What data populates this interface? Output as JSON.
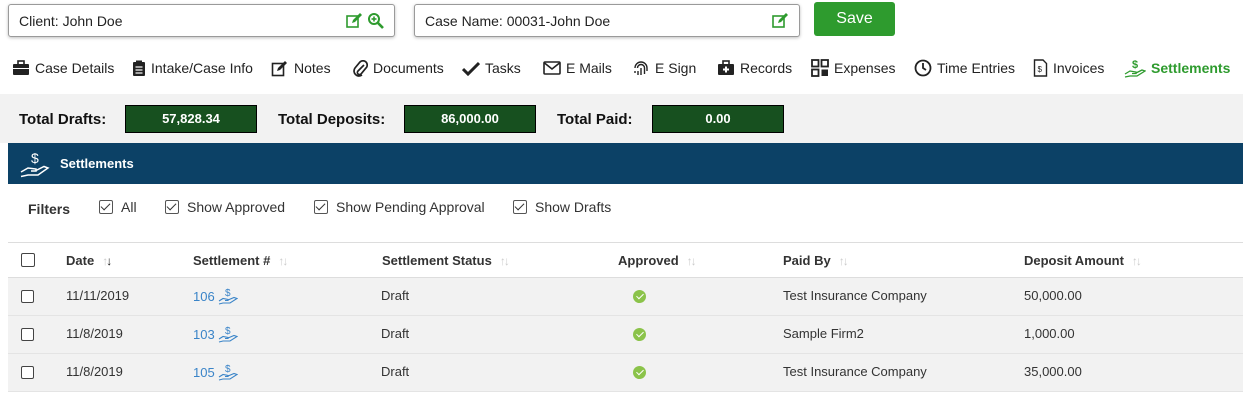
{
  "header": {
    "client_label": "Client: John Doe",
    "case_label": "Case Name: 00031-John Doe",
    "save_label": "Save"
  },
  "tabs": [
    {
      "label": "Case Details",
      "icon": "briefcase-icon"
    },
    {
      "label": "Intake/Case Info",
      "icon": "clipboard-icon"
    },
    {
      "label": "Notes",
      "icon": "edit-icon"
    },
    {
      "label": "Documents",
      "icon": "paperclip-icon"
    },
    {
      "label": "Tasks",
      "icon": "checkmark-icon"
    },
    {
      "label": "E Mails",
      "icon": "envelope-icon"
    },
    {
      "label": "E Sign",
      "icon": "fingerprint-icon"
    },
    {
      "label": "Records",
      "icon": "medical-kit-icon"
    },
    {
      "label": "Expenses",
      "icon": "grid-icon"
    },
    {
      "label": "Time Entries",
      "icon": "clock-icon"
    },
    {
      "label": "Invoices",
      "icon": "invoice-icon"
    },
    {
      "label": "Settlements",
      "icon": "dollar-hand-icon",
      "active": true
    }
  ],
  "totals": {
    "drafts_label": "Total Drafts:",
    "drafts_value": "57,828.34",
    "deposits_label": "Total Deposits:",
    "deposits_value": "86,000.00",
    "paid_label": "Total Paid:",
    "paid_value": "0.00"
  },
  "section": {
    "title": "Settlements"
  },
  "filters": {
    "label": "Filters",
    "options": [
      {
        "label": "All",
        "checked": true
      },
      {
        "label": "Show Approved",
        "checked": true
      },
      {
        "label": "Show Pending Approval",
        "checked": true
      },
      {
        "label": "Show Drafts",
        "checked": true
      }
    ]
  },
  "table": {
    "columns": [
      "Date",
      "Settlement #",
      "Settlement Status",
      "Approved",
      "Paid By",
      "Deposit Amount"
    ],
    "rows": [
      {
        "date": "11/11/2019",
        "number": "106",
        "status": "Draft",
        "approved": true,
        "paid_by": "Test Insurance Company",
        "amount": "50,000.00"
      },
      {
        "date": "11/8/2019",
        "number": "103",
        "status": "Draft",
        "approved": true,
        "paid_by": "Sample Firm2",
        "amount": "1,000.00"
      },
      {
        "date": "11/8/2019",
        "number": "105",
        "status": "Draft",
        "approved": true,
        "paid_by": "Test Insurance Company",
        "amount": "35,000.00"
      }
    ]
  },
  "colors": {
    "accent_green": "#2e9b2e",
    "header_navy": "#0c4166",
    "total_box": "#17501f",
    "link_blue": "#3a84c8",
    "approved_green": "#8bc34a"
  }
}
